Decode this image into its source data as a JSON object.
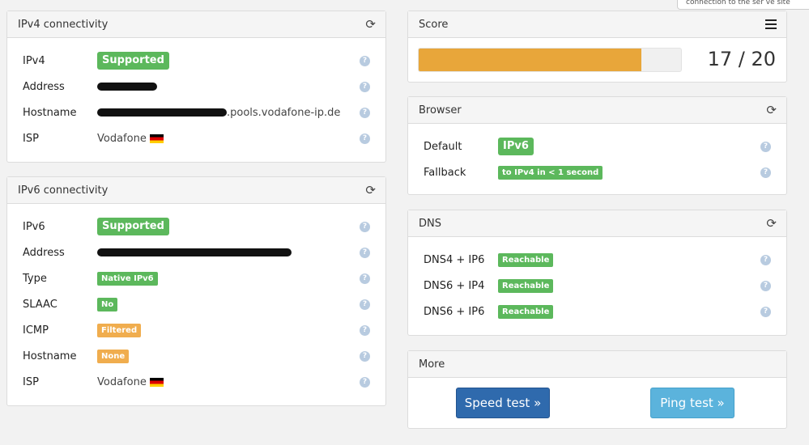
{
  "ipv4": {
    "title": "IPv4 connectivity",
    "rows": [
      {
        "label": "IPv4",
        "value": "Supported"
      },
      {
        "label": "Address",
        "value": ""
      },
      {
        "label": "Hostname",
        "value": ".pools.vodafone-ip.de"
      },
      {
        "label": "ISP",
        "value": "Vodafone"
      }
    ]
  },
  "ipv6": {
    "title": "IPv6 connectivity",
    "rows": [
      {
        "label": "IPv6",
        "value": "Supported"
      },
      {
        "label": "Address",
        "value": ""
      },
      {
        "label": "Type",
        "value": "Native IPv6"
      },
      {
        "label": "SLAAC",
        "value": "No"
      },
      {
        "label": "ICMP",
        "value": "Filtered"
      },
      {
        "label": "Hostname",
        "value": "None"
      },
      {
        "label": "ISP",
        "value": "Vodafone"
      }
    ]
  },
  "score": {
    "title": "Score",
    "text": "17 / 20",
    "value": 17,
    "max": 20,
    "bar_color": "#e8a63a"
  },
  "browser": {
    "title": "Browser",
    "rows": [
      {
        "label": "Default",
        "value": "IPv6"
      },
      {
        "label": "Fallback",
        "value": "to IPv4 in < 1 second"
      }
    ]
  },
  "dns": {
    "title": "DNS",
    "rows": [
      {
        "label": "DNS4 + IP6",
        "value": "Reachable"
      },
      {
        "label": "DNS6 + IP4",
        "value": "Reachable"
      },
      {
        "label": "DNS6 + IP6",
        "value": "Reachable"
      }
    ]
  },
  "more": {
    "title": "More",
    "speed_label": "Speed test »",
    "ping_label": "Ping test »"
  },
  "tooltip": {
    "text": "connection to the ser ve site"
  },
  "colors": {
    "success": "#5cb85c",
    "warning": "#f0ad4e",
    "primary": "#2f6aad",
    "info": "#5bb3dc"
  },
  "help_glyph": "?",
  "refresh_glyph": "⟳"
}
